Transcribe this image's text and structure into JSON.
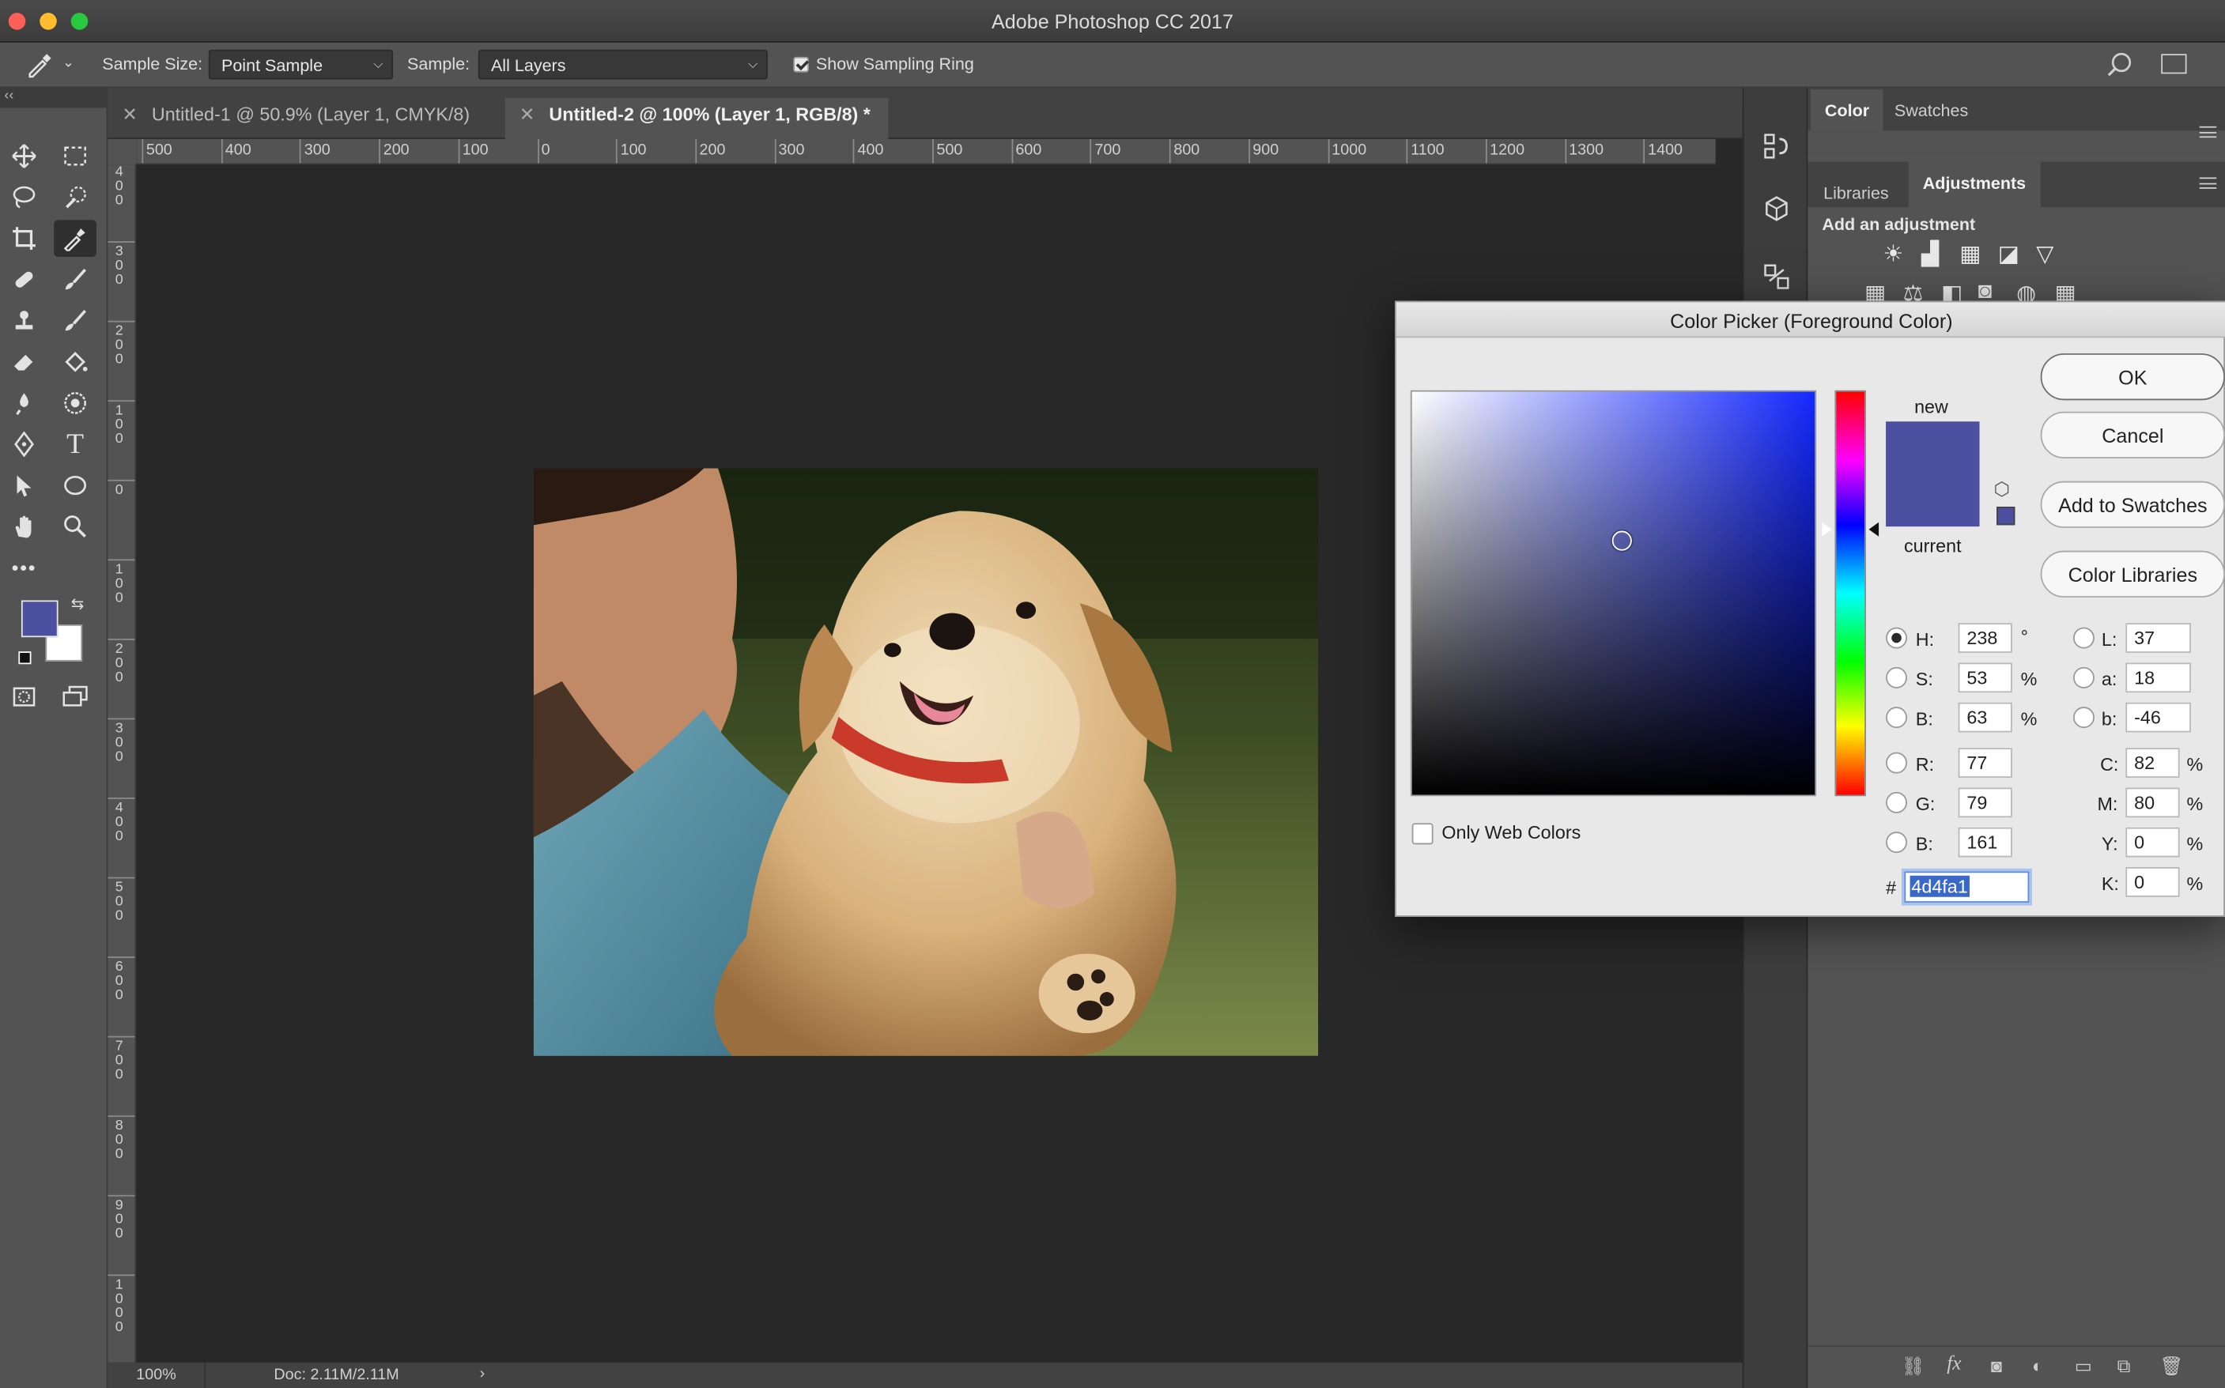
{
  "app": {
    "title": "Adobe Photoshop CC 2017"
  },
  "options_bar": {
    "sample_size_label": "Sample Size:",
    "sample_size_value": "Point Sample",
    "sample_label": "Sample:",
    "sample_value": "All Layers",
    "show_ring_label": "Show Sampling Ring",
    "show_ring_checked": true
  },
  "tabs": [
    {
      "label": "Untitled-1 @ 50.9% (Layer 1, CMYK/8)",
      "active": false
    },
    {
      "label": "Untitled-2 @ 100% (Layer 1, RGB/8) *",
      "active": true
    }
  ],
  "ruler_h": [
    "500",
    "400",
    "300",
    "200",
    "100",
    "0",
    "100",
    "200",
    "300",
    "400",
    "500",
    "600",
    "700",
    "800",
    "900",
    "1000",
    "1100",
    "1200",
    "1300",
    "1400"
  ],
  "ruler_v": [
    "400",
    "300",
    "200",
    "100",
    "0",
    "100",
    "200",
    "300",
    "400",
    "500",
    "600",
    "700",
    "800",
    "900",
    "1000"
  ],
  "status": {
    "zoom": "100%",
    "doc": "Doc: 2.11M/2.11M"
  },
  "panels": {
    "top_tabs": [
      "Color",
      "Swatches"
    ],
    "mid_tabs": [
      "Libraries",
      "Adjustments"
    ],
    "add_adjustment": "Add an adjustment"
  },
  "color_picker": {
    "title": "Color Picker (Foreground Color)",
    "buttons": {
      "ok": "OK",
      "cancel": "Cancel",
      "add_to_swatches": "Add to Swatches",
      "color_libraries": "Color Libraries"
    },
    "new_label": "new",
    "current_label": "current",
    "only_web_colors": "Only Web Colors",
    "hsb": {
      "h_label": "H:",
      "h": "238",
      "h_unit": "°",
      "s_label": "S:",
      "s": "53",
      "s_unit": "%",
      "b_label": "B:",
      "b": "63",
      "b_unit": "%"
    },
    "rgb": {
      "r_label": "R:",
      "r": "77",
      "g_label": "G:",
      "g": "79",
      "b_label": "B:",
      "b": "161"
    },
    "lab": {
      "l_label": "L:",
      "l": "37",
      "a_label": "a:",
      "a": "18",
      "b_label": "b:",
      "b": "-46"
    },
    "cmyk": {
      "c_label": "C:",
      "c": "82",
      "m_label": "M:",
      "m": "80",
      "y_label": "Y:",
      "y": "0",
      "k_label": "K:",
      "k": "0",
      "unit": "%"
    },
    "hex_label": "#",
    "hex": "4d4fa1"
  },
  "colors": {
    "foreground": "#4d4fa1",
    "background": "#ffffff",
    "close": "#fe5f57",
    "minimize": "#febc2e",
    "maximize": "#28c840"
  }
}
